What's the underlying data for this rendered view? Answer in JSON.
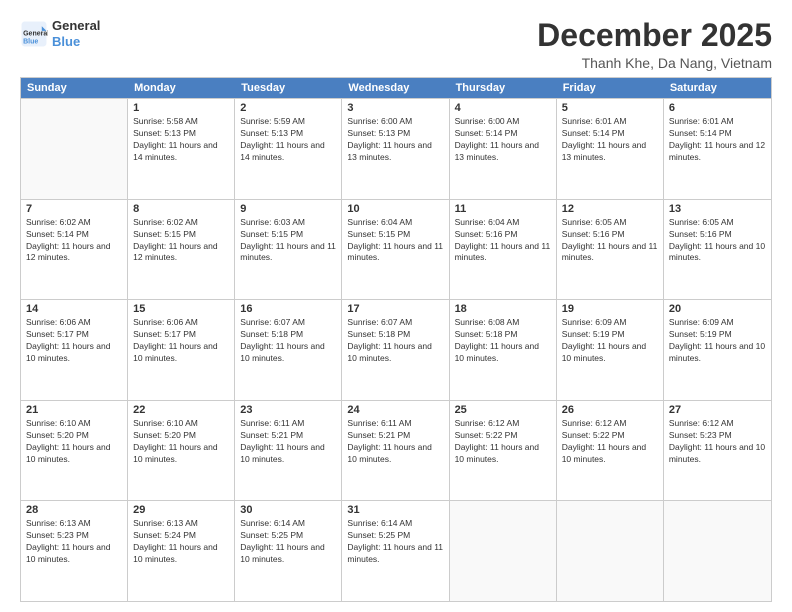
{
  "logo": {
    "line1": "General",
    "line2": "Blue"
  },
  "title": "December 2025",
  "subtitle": "Thanh Khe, Da Nang, Vietnam",
  "header_days": [
    "Sunday",
    "Monday",
    "Tuesday",
    "Wednesday",
    "Thursday",
    "Friday",
    "Saturday"
  ],
  "rows": [
    [
      {
        "day": "",
        "empty": true
      },
      {
        "day": "1",
        "sunrise": "Sunrise: 5:58 AM",
        "sunset": "Sunset: 5:13 PM",
        "daylight": "Daylight: 11 hours and 14 minutes."
      },
      {
        "day": "2",
        "sunrise": "Sunrise: 5:59 AM",
        "sunset": "Sunset: 5:13 PM",
        "daylight": "Daylight: 11 hours and 14 minutes."
      },
      {
        "day": "3",
        "sunrise": "Sunrise: 6:00 AM",
        "sunset": "Sunset: 5:13 PM",
        "daylight": "Daylight: 11 hours and 13 minutes."
      },
      {
        "day": "4",
        "sunrise": "Sunrise: 6:00 AM",
        "sunset": "Sunset: 5:14 PM",
        "daylight": "Daylight: 11 hours and 13 minutes."
      },
      {
        "day": "5",
        "sunrise": "Sunrise: 6:01 AM",
        "sunset": "Sunset: 5:14 PM",
        "daylight": "Daylight: 11 hours and 13 minutes."
      },
      {
        "day": "6",
        "sunrise": "Sunrise: 6:01 AM",
        "sunset": "Sunset: 5:14 PM",
        "daylight": "Daylight: 11 hours and 12 minutes."
      }
    ],
    [
      {
        "day": "7",
        "sunrise": "Sunrise: 6:02 AM",
        "sunset": "Sunset: 5:14 PM",
        "daylight": "Daylight: 11 hours and 12 minutes."
      },
      {
        "day": "8",
        "sunrise": "Sunrise: 6:02 AM",
        "sunset": "Sunset: 5:15 PM",
        "daylight": "Daylight: 11 hours and 12 minutes."
      },
      {
        "day": "9",
        "sunrise": "Sunrise: 6:03 AM",
        "sunset": "Sunset: 5:15 PM",
        "daylight": "Daylight: 11 hours and 11 minutes."
      },
      {
        "day": "10",
        "sunrise": "Sunrise: 6:04 AM",
        "sunset": "Sunset: 5:15 PM",
        "daylight": "Daylight: 11 hours and 11 minutes."
      },
      {
        "day": "11",
        "sunrise": "Sunrise: 6:04 AM",
        "sunset": "Sunset: 5:16 PM",
        "daylight": "Daylight: 11 hours and 11 minutes."
      },
      {
        "day": "12",
        "sunrise": "Sunrise: 6:05 AM",
        "sunset": "Sunset: 5:16 PM",
        "daylight": "Daylight: 11 hours and 11 minutes."
      },
      {
        "day": "13",
        "sunrise": "Sunrise: 6:05 AM",
        "sunset": "Sunset: 5:16 PM",
        "daylight": "Daylight: 11 hours and 10 minutes."
      }
    ],
    [
      {
        "day": "14",
        "sunrise": "Sunrise: 6:06 AM",
        "sunset": "Sunset: 5:17 PM",
        "daylight": "Daylight: 11 hours and 10 minutes."
      },
      {
        "day": "15",
        "sunrise": "Sunrise: 6:06 AM",
        "sunset": "Sunset: 5:17 PM",
        "daylight": "Daylight: 11 hours and 10 minutes."
      },
      {
        "day": "16",
        "sunrise": "Sunrise: 6:07 AM",
        "sunset": "Sunset: 5:18 PM",
        "daylight": "Daylight: 11 hours and 10 minutes."
      },
      {
        "day": "17",
        "sunrise": "Sunrise: 6:07 AM",
        "sunset": "Sunset: 5:18 PM",
        "daylight": "Daylight: 11 hours and 10 minutes."
      },
      {
        "day": "18",
        "sunrise": "Sunrise: 6:08 AM",
        "sunset": "Sunset: 5:18 PM",
        "daylight": "Daylight: 11 hours and 10 minutes."
      },
      {
        "day": "19",
        "sunrise": "Sunrise: 6:09 AM",
        "sunset": "Sunset: 5:19 PM",
        "daylight": "Daylight: 11 hours and 10 minutes."
      },
      {
        "day": "20",
        "sunrise": "Sunrise: 6:09 AM",
        "sunset": "Sunset: 5:19 PM",
        "daylight": "Daylight: 11 hours and 10 minutes."
      }
    ],
    [
      {
        "day": "21",
        "sunrise": "Sunrise: 6:10 AM",
        "sunset": "Sunset: 5:20 PM",
        "daylight": "Daylight: 11 hours and 10 minutes."
      },
      {
        "day": "22",
        "sunrise": "Sunrise: 6:10 AM",
        "sunset": "Sunset: 5:20 PM",
        "daylight": "Daylight: 11 hours and 10 minutes."
      },
      {
        "day": "23",
        "sunrise": "Sunrise: 6:11 AM",
        "sunset": "Sunset: 5:21 PM",
        "daylight": "Daylight: 11 hours and 10 minutes."
      },
      {
        "day": "24",
        "sunrise": "Sunrise: 6:11 AM",
        "sunset": "Sunset: 5:21 PM",
        "daylight": "Daylight: 11 hours and 10 minutes."
      },
      {
        "day": "25",
        "sunrise": "Sunrise: 6:12 AM",
        "sunset": "Sunset: 5:22 PM",
        "daylight": "Daylight: 11 hours and 10 minutes."
      },
      {
        "day": "26",
        "sunrise": "Sunrise: 6:12 AM",
        "sunset": "Sunset: 5:22 PM",
        "daylight": "Daylight: 11 hours and 10 minutes."
      },
      {
        "day": "27",
        "sunrise": "Sunrise: 6:12 AM",
        "sunset": "Sunset: 5:23 PM",
        "daylight": "Daylight: 11 hours and 10 minutes."
      }
    ],
    [
      {
        "day": "28",
        "sunrise": "Sunrise: 6:13 AM",
        "sunset": "Sunset: 5:23 PM",
        "daylight": "Daylight: 11 hours and 10 minutes."
      },
      {
        "day": "29",
        "sunrise": "Sunrise: 6:13 AM",
        "sunset": "Sunset: 5:24 PM",
        "daylight": "Daylight: 11 hours and 10 minutes."
      },
      {
        "day": "30",
        "sunrise": "Sunrise: 6:14 AM",
        "sunset": "Sunset: 5:25 PM",
        "daylight": "Daylight: 11 hours and 10 minutes."
      },
      {
        "day": "31",
        "sunrise": "Sunrise: 6:14 AM",
        "sunset": "Sunset: 5:25 PM",
        "daylight": "Daylight: 11 hours and 11 minutes."
      },
      {
        "day": "",
        "empty": true
      },
      {
        "day": "",
        "empty": true
      },
      {
        "day": "",
        "empty": true
      }
    ]
  ]
}
